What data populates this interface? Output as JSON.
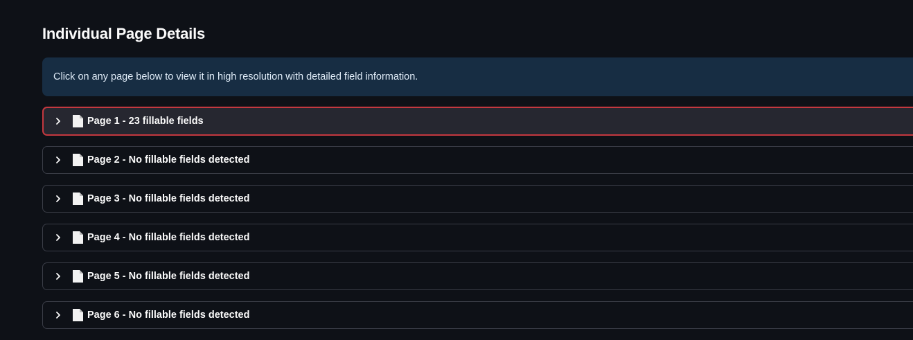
{
  "section": {
    "title": "Individual Page Details",
    "info": "Click on any page below to view it in high resolution with detailed field information."
  },
  "icons": {
    "chevron": "chevron-right-icon",
    "page": "document-page-icon"
  },
  "colors": {
    "background": "#0e1117",
    "info_background": "#172d43",
    "focus_border": "#c4383f",
    "border": "#3a3d47"
  },
  "pages": [
    {
      "label": "Page 1 - 23 fillable fields",
      "focused": true
    },
    {
      "label": "Page 2 - No fillable fields detected",
      "focused": false
    },
    {
      "label": "Page 3 - No fillable fields detected",
      "focused": false
    },
    {
      "label": "Page 4 - No fillable fields detected",
      "focused": false
    },
    {
      "label": "Page 5 - No fillable fields detected",
      "focused": false
    },
    {
      "label": "Page 6 - No fillable fields detected",
      "focused": false
    }
  ]
}
